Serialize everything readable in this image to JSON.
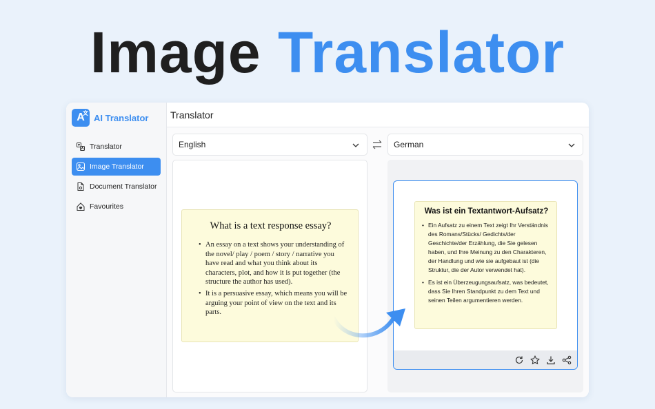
{
  "hero": {
    "word1": "Image",
    "word2": "Translator"
  },
  "app": {
    "brand_name": "AI Translator",
    "logo_letter": "A",
    "logo_sub": "文"
  },
  "sidebar": {
    "items": [
      {
        "label": "Translator",
        "icon": "translate-icon",
        "active": false
      },
      {
        "label": "Image Translator",
        "icon": "image-translate-icon",
        "active": true
      },
      {
        "label": "Document Translator",
        "icon": "document-icon",
        "active": false
      },
      {
        "label": "Favourites",
        "icon": "favourite-icon",
        "active": false
      }
    ]
  },
  "header": {
    "title": "Translator"
  },
  "languages": {
    "source": "English",
    "target": "German"
  },
  "source_image": {
    "title": "What is a text response essay?",
    "bullets": [
      "An essay on a text shows your understanding of the novel/ play / poem / story / narrative you have read and what you think about its characters, plot, and how it is put together (the structure the author has used).",
      "It is a persuasive essay, which means you will be arguing your point of view on the text and its parts."
    ]
  },
  "translated_image": {
    "title": "Was ist ein Textantwort-Aufsatz?",
    "bullets": [
      "Ein Aufsatz zu einem Text zeigt Ihr Verständnis des Romans/Stücks/ Gedichts/der Geschichte/der Erzählung, die Sie gelesen haben, und Ihre Meinung zu den Charakteren, der Handlung und wie sie aufgebaut ist (die Struktur, die der Autor verwendet hat).",
      "Es ist ein Überzeugungsaufsatz, was bedeutet, dass Sie Ihren Standpunkt zu dem Text und seinen Teilen argumentieren werden."
    ]
  },
  "actions": [
    "refresh-icon",
    "star-icon",
    "download-icon",
    "share-icon"
  ],
  "colors": {
    "accent": "#3d8ef0",
    "note_bg": "#fdfbdc",
    "page_bg": "#eaf2fb"
  }
}
